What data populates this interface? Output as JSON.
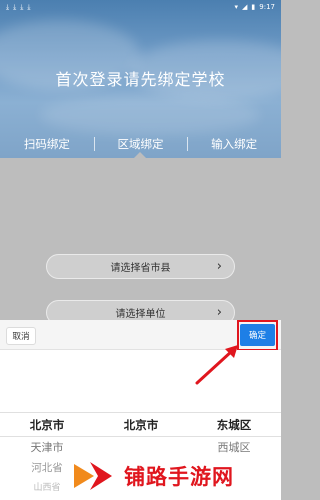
{
  "status_bar": {
    "time": "9:17",
    "left_icons": [
      "download-icon",
      "download-icon",
      "download-icon",
      "download-icon"
    ],
    "right_icons": [
      "wifi-icon",
      "signal-icon",
      "battery-icon"
    ]
  },
  "header": {
    "title": "首次登录请先绑定学校",
    "tabs": [
      {
        "label": "扫码绑定"
      },
      {
        "label": "区域绑定"
      },
      {
        "label": "输入绑定"
      }
    ]
  },
  "form": {
    "region_select": "请选择省市县",
    "school_select": "请选择单位"
  },
  "picker": {
    "cancel_label": "取消",
    "confirm_label": "确定",
    "columns": [
      {
        "selected": "北京市",
        "next": [
          "天津市",
          "河北省",
          "山西省"
        ]
      },
      {
        "selected": "北京市",
        "next": [
          "",
          "",
          ""
        ]
      },
      {
        "selected": "东城区",
        "next": [
          "西城区",
          "",
          ""
        ]
      }
    ]
  },
  "watermark": {
    "text": "铺路手游网"
  },
  "colors": {
    "accent": "#1e7fe6",
    "highlight": "#e0161e"
  }
}
